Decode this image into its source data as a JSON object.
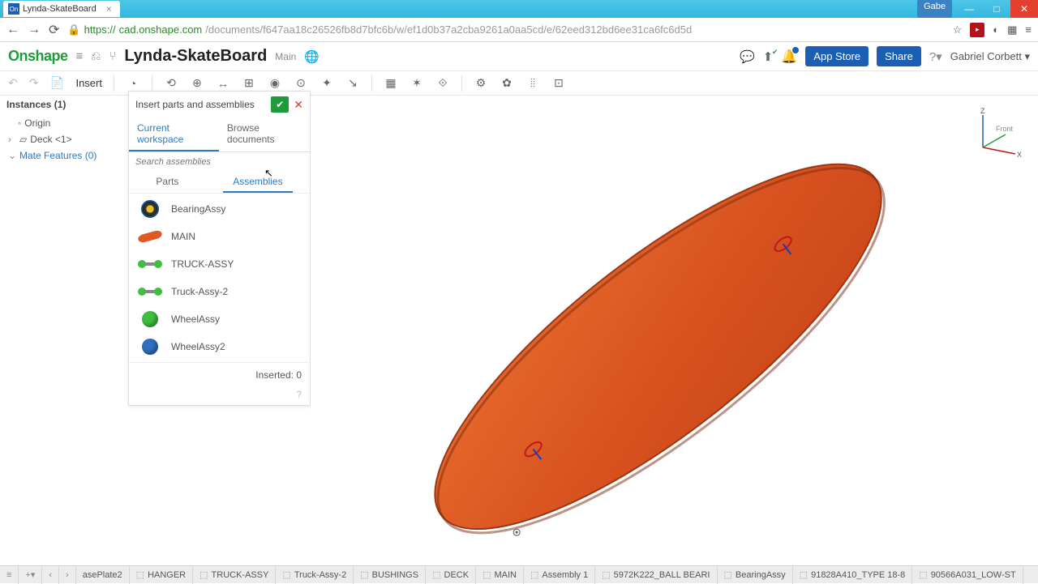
{
  "window": {
    "tab_title": "Lynda-SkateBoard",
    "user_badge": "Gabe"
  },
  "address": {
    "host": "cad.onshape.com",
    "path": "/documents/f647aa18c26526fb8d7bfc6b/w/ef1d0b37a2cba9261a0aa5cd/e/62eed312bd6ee31ca6fc6d5d",
    "scheme": "https://"
  },
  "header": {
    "logo": "Onshape",
    "doc_name": "Lynda-SkateBoard",
    "branch": "Main",
    "appstore": "App Store",
    "share": "Share",
    "user": "Gabriel Corbett"
  },
  "toolbar": {
    "insert": "Insert"
  },
  "instances": {
    "title": "Instances (1)",
    "origin": "Origin",
    "deck": "Deck <1>",
    "mate_features": "Mate Features (0)"
  },
  "dialog": {
    "title": "Insert parts and assemblies",
    "ws_current": "Current workspace",
    "ws_browse": "Browse documents",
    "search_placeholder": "Search assemblies",
    "tab_parts": "Parts",
    "tab_assemblies": "Assemblies",
    "items": {
      "bearing": "BearingAssy",
      "main": "MAIN",
      "truck1": "TRUCK-ASSY",
      "truck2": "Truck-Assy-2",
      "wheel1": "WheelAssy",
      "wheel2": "WheelAssy2"
    },
    "inserted_label": "Inserted:",
    "inserted_count": "0"
  },
  "triad": {
    "z": "Z",
    "x": "X",
    "front": "Front"
  },
  "bottom_tabs": {
    "t0": "asePlate2",
    "t1": "HANGER",
    "t2": "TRUCK-ASSY",
    "t3": "Truck-Assy-2",
    "t4": "BUSHINGS",
    "t5": "DECK",
    "t6": "MAIN",
    "t7": "Assembly 1",
    "t8": "5972K222_BALL BEARI",
    "t9": "BearingAssy",
    "t10": "91828A410_TYPE 18-8",
    "t11": "90566A031_LOW-ST"
  }
}
